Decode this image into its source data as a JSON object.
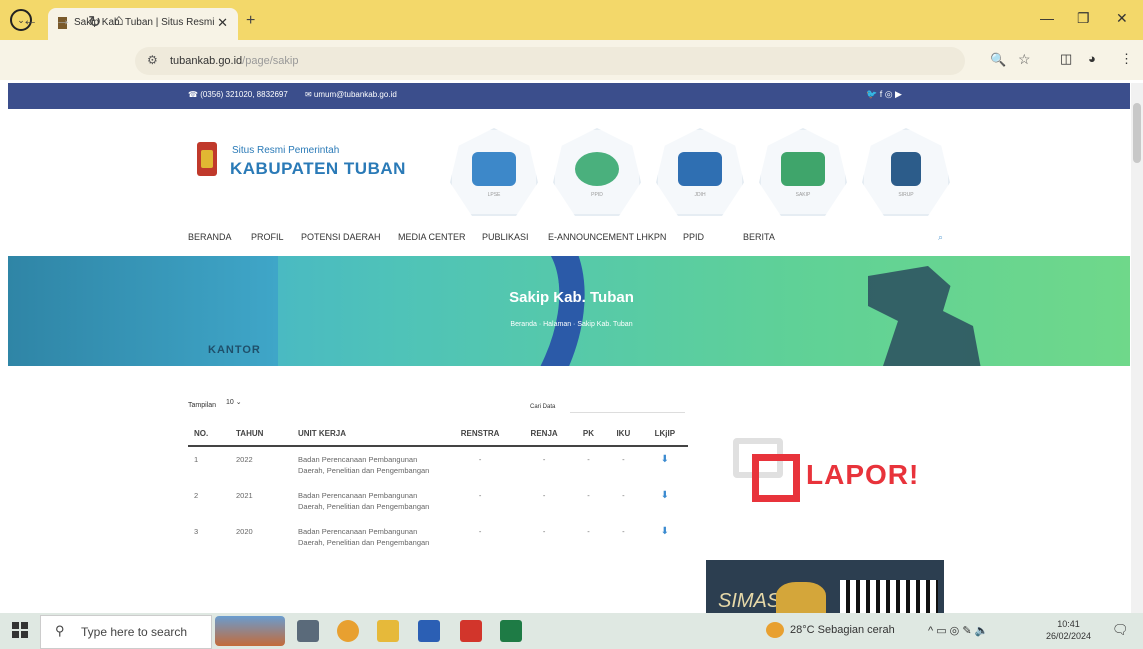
{
  "browser": {
    "tab_title": "Sakip Kab. Tuban | Situs Resmi",
    "url_host": "tubankab.go.id",
    "url_path": "/page/sakip",
    "new_tab": "+",
    "close": "✕",
    "minimize": "—",
    "restore": "❐",
    "window_close": "✕"
  },
  "site_topbar": {
    "phone": "☎ (0356) 321020, 8832697",
    "email": "✉ umum@tubankab.go.id",
    "social": "🐦  f  ◎  ▶"
  },
  "header": {
    "subtitle": "Situs Resmi Pemerintah",
    "title": "KABUPATEN TUBAN",
    "quick_links": [
      "LPSE",
      "PPID",
      "JDIH",
      "SAKIP",
      "SIRUP"
    ]
  },
  "menu": [
    "BERANDA",
    "PROFIL",
    "POTENSI DAERAH",
    "MEDIA CENTER",
    "PUBLIKASI",
    "E-ANNOUNCEMENT LHKPN",
    "PPID",
    "BERITA"
  ],
  "banner": {
    "title": "Sakip Kab. Tuban",
    "breadcrumb": "Beranda   ·   Halaman   ·   Sakip Kab. Tuban",
    "kantor": "KANTOR"
  },
  "table_controls": {
    "show_label": "Tampilan",
    "show_value": "10",
    "search_label": "Cari Data"
  },
  "table": {
    "headers": [
      "NO.",
      "TAHUN",
      "UNIT KERJA",
      "RENSTRA",
      "RENJA",
      "PK",
      "IKU",
      "LKjIP"
    ],
    "rows": [
      {
        "no": "1",
        "tahun": "2022",
        "unit": "Badan Perencanaan Pembangunan Daerah, Penelitian dan Pengembangan",
        "renstra": "-",
        "renja": "-",
        "pk": "-",
        "iku": "-"
      },
      {
        "no": "2",
        "tahun": "2021",
        "unit": "Badan Perencanaan Pembangunan Daerah, Penelitian dan Pengembangan",
        "renstra": "-",
        "renja": "-",
        "pk": "-",
        "iku": "-"
      },
      {
        "no": "3",
        "tahun": "2020",
        "unit": "Badan Perencanaan Pembangunan Daerah, Penelitian dan Pengembangan",
        "renstra": "-",
        "renja": "-",
        "pk": "-",
        "iku": "-"
      }
    ]
  },
  "sidebar": {
    "lapor": "LAPOR!",
    "simas": "SIMAS"
  },
  "taskbar": {
    "search_placeholder": "Type here to search",
    "weather": "28°C  Sebagian cerah",
    "time": "10:41",
    "date": "26/02/2024"
  }
}
